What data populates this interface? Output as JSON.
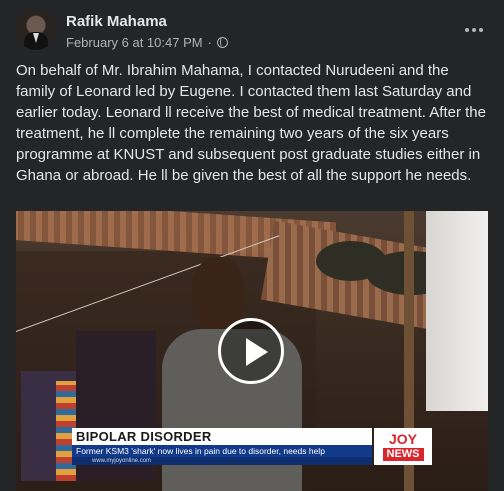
{
  "post": {
    "author": "Rafik Mahama",
    "timestamp": "February 6 at 10:47 PM",
    "separator": "·",
    "privacy_icon": "globe-icon",
    "more_icon": "more-options-icon",
    "text": "On behalf of Mr. Ibrahim Mahama, I contacted Nurudeeni and the family of Leonard led by Eugene. I contacted them last Saturday and earlier today. Leonard ll receive the best of medical treatment. After the treatment, he ll complete the remaining two years of the six years programme at KNUST and subsequent post graduate studies either in Ghana or abroad. He ll be given the best of all the support he needs."
  },
  "video": {
    "play_icon": "play-icon",
    "headline": "BIPOLAR DISORDER",
    "subline": "Former KSM3 'shark' now lives in pain due to disorder, needs help",
    "url": "www.myjoyonline.com",
    "logo_top": "JOY",
    "logo_bottom": "NEWS"
  },
  "colors": {
    "background": "#242526",
    "text_primary": "#e4e6eb",
    "text_secondary": "#b0b3b8",
    "news_blue": "#123a8a",
    "news_red": "#d9262c"
  }
}
